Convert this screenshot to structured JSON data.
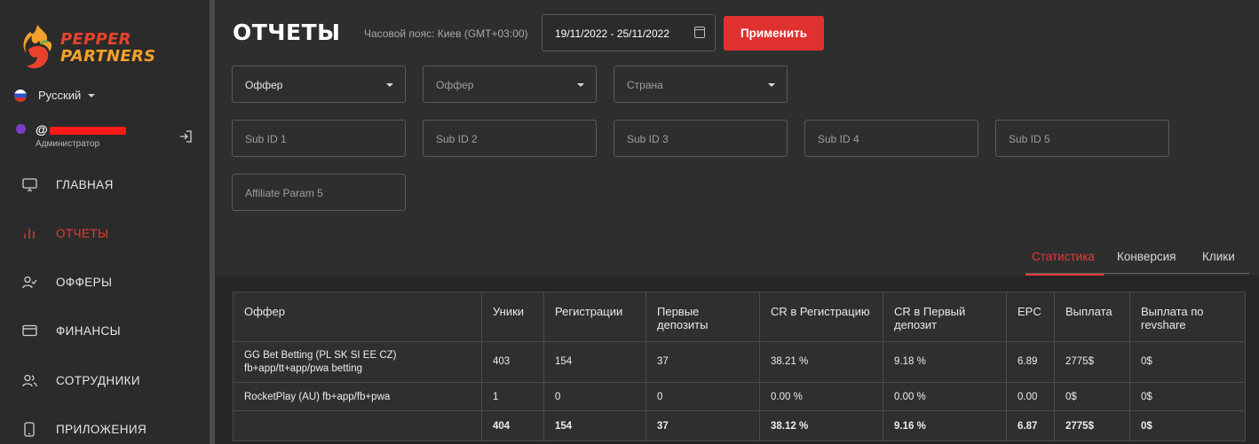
{
  "brand": {
    "line1": "PEPPER",
    "line2": "PARTNERS"
  },
  "sidebar": {
    "language": "Русский",
    "user": {
      "name_prefix": "@",
      "role": "Администратор"
    },
    "nav": [
      {
        "label": "ГЛАВНАЯ",
        "icon": "monitor-icon"
      },
      {
        "label": "ОТЧЕТЫ",
        "icon": "bar-chart-icon",
        "active": true
      },
      {
        "label": "ОФФЕРЫ",
        "icon": "user-check-icon"
      },
      {
        "label": "ФИНАНСЫ",
        "icon": "credit-card-icon"
      },
      {
        "label": "СОТРУДНИКИ",
        "icon": "users-icon"
      },
      {
        "label": "ПРИЛОЖЕНИЯ",
        "icon": "smartphone-icon"
      }
    ]
  },
  "header": {
    "title": "ОТЧЕТЫ",
    "timezone": "Часовой пояс: Киев (GMT+03:00)",
    "date_range": "19/11/2022 - 25/11/2022",
    "apply_label": "Применить"
  },
  "filters": {
    "offer_select": "Оффер",
    "offer_select2": "Оффер",
    "country_select": "Страна",
    "sub_ids": [
      "Sub ID 1",
      "Sub ID 2",
      "Sub ID 3",
      "Sub ID 4",
      "Sub ID 5"
    ],
    "affiliate_param": "Affiliate Param 5"
  },
  "tabs": [
    "Статистика",
    "Конверсия",
    "Клики"
  ],
  "table": {
    "headers": [
      "Оффер",
      "Уники",
      "Регистрации",
      "Первые депозиты",
      "CR в Регистрацию",
      "CR в Первый депозит",
      "EPC",
      "Выплата",
      "Выплата по revshare"
    ],
    "rows": [
      [
        "GG Bet Betting (PL SK SI EE CZ) fb+app/tt+app/pwa betting",
        "403",
        "154",
        "37",
        "38.21 %",
        "9.18 %",
        "6.89",
        "2775$",
        "0$"
      ],
      [
        "RocketPlay (AU) fb+app/fb+pwa",
        "1",
        "0",
        "0",
        "0.00 %",
        "0.00 %",
        "0.00",
        "0$",
        "0$"
      ]
    ],
    "totals": [
      "",
      "404",
      "154",
      "37",
      "38.12 %",
      "9.16 %",
      "6.87",
      "2775$",
      "0$"
    ]
  },
  "colors": {
    "accent": "#e53935",
    "button": "#e03131",
    "logo_red": "#e8432a",
    "logo_orange": "#f3a12a"
  }
}
